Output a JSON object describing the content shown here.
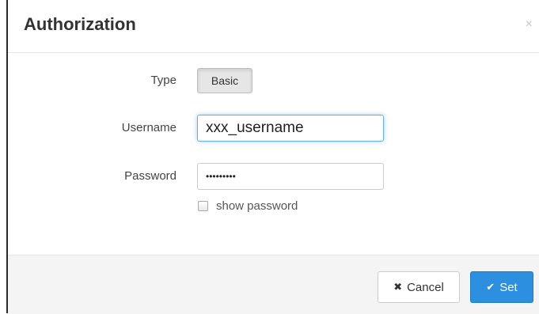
{
  "dialog": {
    "title": "Authorization",
    "close_glyph": "×"
  },
  "form": {
    "type_label": "Type",
    "type_value": "Basic",
    "username_label": "Username",
    "username_value": "xxx_username",
    "password_label": "Password",
    "password_value": "•••••••••",
    "show_password_label": "show password",
    "show_password_checked": false
  },
  "footer": {
    "cancel_icon": "✖",
    "cancel_label": "Cancel",
    "set_icon": "✔",
    "set_label": "Set"
  },
  "colors": {
    "primary": "#2d8fe0",
    "focus_border": "#66afe9"
  },
  "icons": {
    "close": "close-icon",
    "cancel": "x-icon",
    "set": "check-icon"
  }
}
